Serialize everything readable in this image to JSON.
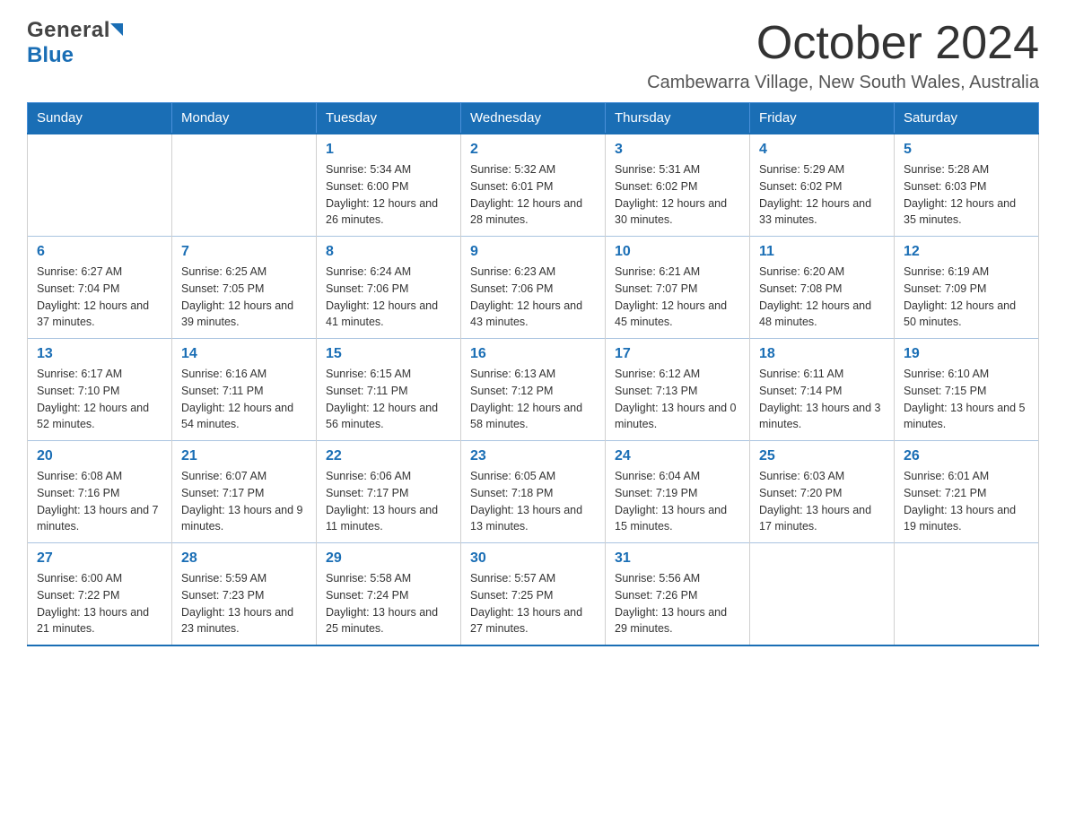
{
  "logo": {
    "text1": "General",
    "text2": "Blue"
  },
  "header": {
    "title": "October 2024",
    "subtitle": "Cambewarra Village, New South Wales, Australia"
  },
  "weekdays": [
    "Sunday",
    "Monday",
    "Tuesday",
    "Wednesday",
    "Thursday",
    "Friday",
    "Saturday"
  ],
  "weeks": [
    [
      {
        "day": "",
        "sunrise": "",
        "sunset": "",
        "daylight": ""
      },
      {
        "day": "",
        "sunrise": "",
        "sunset": "",
        "daylight": ""
      },
      {
        "day": "1",
        "sunrise": "Sunrise: 5:34 AM",
        "sunset": "Sunset: 6:00 PM",
        "daylight": "Daylight: 12 hours and 26 minutes."
      },
      {
        "day": "2",
        "sunrise": "Sunrise: 5:32 AM",
        "sunset": "Sunset: 6:01 PM",
        "daylight": "Daylight: 12 hours and 28 minutes."
      },
      {
        "day": "3",
        "sunrise": "Sunrise: 5:31 AM",
        "sunset": "Sunset: 6:02 PM",
        "daylight": "Daylight: 12 hours and 30 minutes."
      },
      {
        "day": "4",
        "sunrise": "Sunrise: 5:29 AM",
        "sunset": "Sunset: 6:02 PM",
        "daylight": "Daylight: 12 hours and 33 minutes."
      },
      {
        "day": "5",
        "sunrise": "Sunrise: 5:28 AM",
        "sunset": "Sunset: 6:03 PM",
        "daylight": "Daylight: 12 hours and 35 minutes."
      }
    ],
    [
      {
        "day": "6",
        "sunrise": "Sunrise: 6:27 AM",
        "sunset": "Sunset: 7:04 PM",
        "daylight": "Daylight: 12 hours and 37 minutes."
      },
      {
        "day": "7",
        "sunrise": "Sunrise: 6:25 AM",
        "sunset": "Sunset: 7:05 PM",
        "daylight": "Daylight: 12 hours and 39 minutes."
      },
      {
        "day": "8",
        "sunrise": "Sunrise: 6:24 AM",
        "sunset": "Sunset: 7:06 PM",
        "daylight": "Daylight: 12 hours and 41 minutes."
      },
      {
        "day": "9",
        "sunrise": "Sunrise: 6:23 AM",
        "sunset": "Sunset: 7:06 PM",
        "daylight": "Daylight: 12 hours and 43 minutes."
      },
      {
        "day": "10",
        "sunrise": "Sunrise: 6:21 AM",
        "sunset": "Sunset: 7:07 PM",
        "daylight": "Daylight: 12 hours and 45 minutes."
      },
      {
        "day": "11",
        "sunrise": "Sunrise: 6:20 AM",
        "sunset": "Sunset: 7:08 PM",
        "daylight": "Daylight: 12 hours and 48 minutes."
      },
      {
        "day": "12",
        "sunrise": "Sunrise: 6:19 AM",
        "sunset": "Sunset: 7:09 PM",
        "daylight": "Daylight: 12 hours and 50 minutes."
      }
    ],
    [
      {
        "day": "13",
        "sunrise": "Sunrise: 6:17 AM",
        "sunset": "Sunset: 7:10 PM",
        "daylight": "Daylight: 12 hours and 52 minutes."
      },
      {
        "day": "14",
        "sunrise": "Sunrise: 6:16 AM",
        "sunset": "Sunset: 7:11 PM",
        "daylight": "Daylight: 12 hours and 54 minutes."
      },
      {
        "day": "15",
        "sunrise": "Sunrise: 6:15 AM",
        "sunset": "Sunset: 7:11 PM",
        "daylight": "Daylight: 12 hours and 56 minutes."
      },
      {
        "day": "16",
        "sunrise": "Sunrise: 6:13 AM",
        "sunset": "Sunset: 7:12 PM",
        "daylight": "Daylight: 12 hours and 58 minutes."
      },
      {
        "day": "17",
        "sunrise": "Sunrise: 6:12 AM",
        "sunset": "Sunset: 7:13 PM",
        "daylight": "Daylight: 13 hours and 0 minutes."
      },
      {
        "day": "18",
        "sunrise": "Sunrise: 6:11 AM",
        "sunset": "Sunset: 7:14 PM",
        "daylight": "Daylight: 13 hours and 3 minutes."
      },
      {
        "day": "19",
        "sunrise": "Sunrise: 6:10 AM",
        "sunset": "Sunset: 7:15 PM",
        "daylight": "Daylight: 13 hours and 5 minutes."
      }
    ],
    [
      {
        "day": "20",
        "sunrise": "Sunrise: 6:08 AM",
        "sunset": "Sunset: 7:16 PM",
        "daylight": "Daylight: 13 hours and 7 minutes."
      },
      {
        "day": "21",
        "sunrise": "Sunrise: 6:07 AM",
        "sunset": "Sunset: 7:17 PM",
        "daylight": "Daylight: 13 hours and 9 minutes."
      },
      {
        "day": "22",
        "sunrise": "Sunrise: 6:06 AM",
        "sunset": "Sunset: 7:17 PM",
        "daylight": "Daylight: 13 hours and 11 minutes."
      },
      {
        "day": "23",
        "sunrise": "Sunrise: 6:05 AM",
        "sunset": "Sunset: 7:18 PM",
        "daylight": "Daylight: 13 hours and 13 minutes."
      },
      {
        "day": "24",
        "sunrise": "Sunrise: 6:04 AM",
        "sunset": "Sunset: 7:19 PM",
        "daylight": "Daylight: 13 hours and 15 minutes."
      },
      {
        "day": "25",
        "sunrise": "Sunrise: 6:03 AM",
        "sunset": "Sunset: 7:20 PM",
        "daylight": "Daylight: 13 hours and 17 minutes."
      },
      {
        "day": "26",
        "sunrise": "Sunrise: 6:01 AM",
        "sunset": "Sunset: 7:21 PM",
        "daylight": "Daylight: 13 hours and 19 minutes."
      }
    ],
    [
      {
        "day": "27",
        "sunrise": "Sunrise: 6:00 AM",
        "sunset": "Sunset: 7:22 PM",
        "daylight": "Daylight: 13 hours and 21 minutes."
      },
      {
        "day": "28",
        "sunrise": "Sunrise: 5:59 AM",
        "sunset": "Sunset: 7:23 PM",
        "daylight": "Daylight: 13 hours and 23 minutes."
      },
      {
        "day": "29",
        "sunrise": "Sunrise: 5:58 AM",
        "sunset": "Sunset: 7:24 PM",
        "daylight": "Daylight: 13 hours and 25 minutes."
      },
      {
        "day": "30",
        "sunrise": "Sunrise: 5:57 AM",
        "sunset": "Sunset: 7:25 PM",
        "daylight": "Daylight: 13 hours and 27 minutes."
      },
      {
        "day": "31",
        "sunrise": "Sunrise: 5:56 AM",
        "sunset": "Sunset: 7:26 PM",
        "daylight": "Daylight: 13 hours and 29 minutes."
      },
      {
        "day": "",
        "sunrise": "",
        "sunset": "",
        "daylight": ""
      },
      {
        "day": "",
        "sunrise": "",
        "sunset": "",
        "daylight": ""
      }
    ]
  ]
}
